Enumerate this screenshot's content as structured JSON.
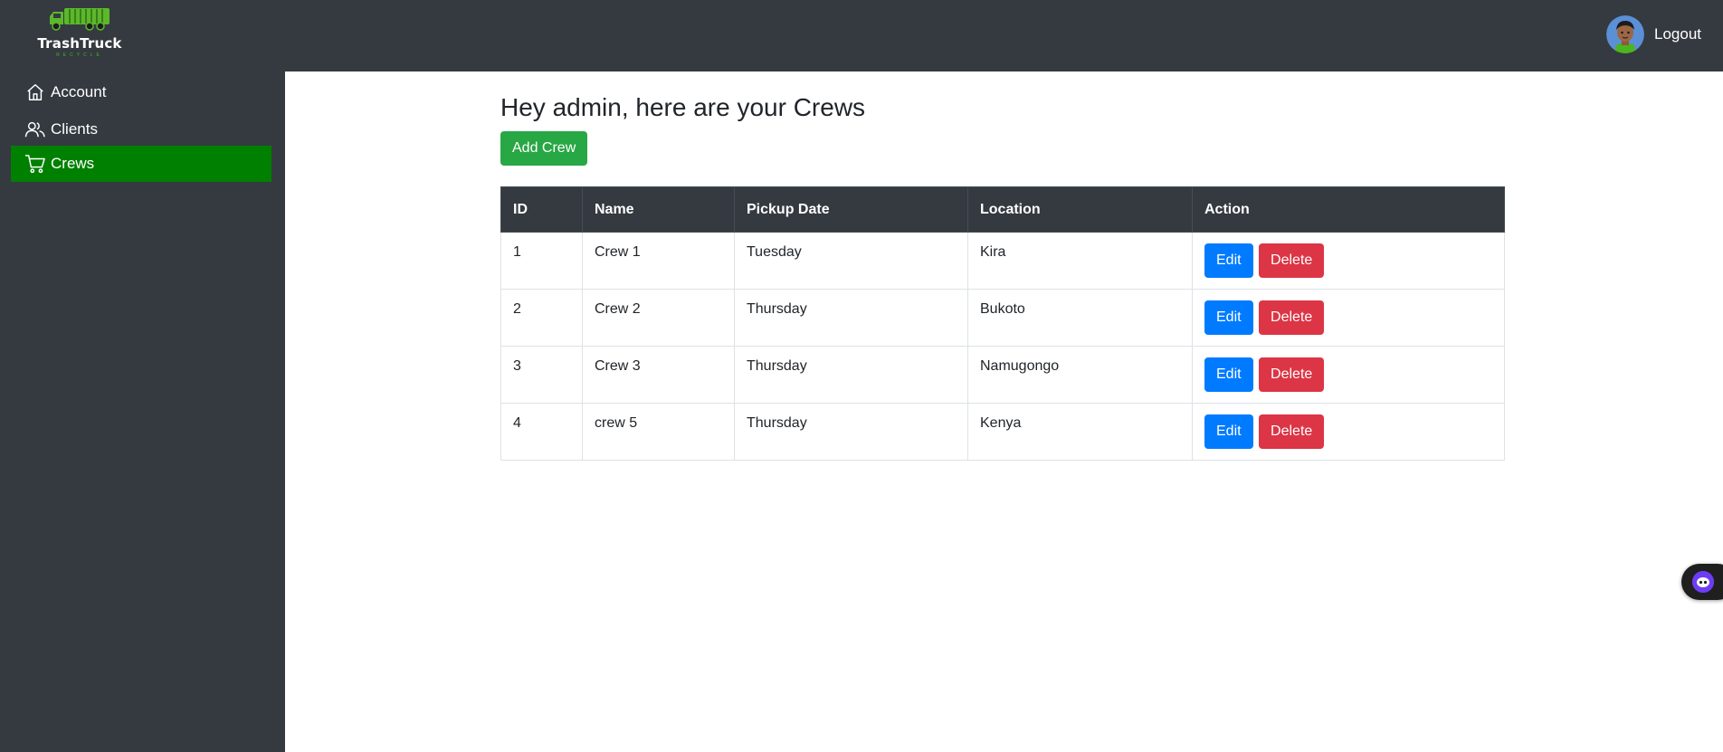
{
  "app": {
    "name": "TrashTruck",
    "tagline": "RECYCLE"
  },
  "header": {
    "logout_label": "Logout"
  },
  "sidebar": {
    "items": [
      {
        "label": "Account",
        "icon": "home-icon",
        "active": false
      },
      {
        "label": "Clients",
        "icon": "users-icon",
        "active": false
      },
      {
        "label": "Crews",
        "icon": "cart-icon",
        "active": true
      }
    ]
  },
  "main": {
    "title": "Hey admin, here are your Crews",
    "add_button": "Add Crew",
    "table": {
      "columns": [
        "ID",
        "Name",
        "Pickup Date",
        "Location",
        "Action"
      ],
      "rows": [
        {
          "id": "1",
          "name": "Crew 1",
          "pickup_date": "Tuesday",
          "location": "Kira"
        },
        {
          "id": "2",
          "name": "Crew 2",
          "pickup_date": "Thursday",
          "location": "Bukoto"
        },
        {
          "id": "3",
          "name": "Crew 3",
          "pickup_date": "Thursday",
          "location": "Namugongo"
        },
        {
          "id": "4",
          "name": "crew 5",
          "pickup_date": "Thursday",
          "location": "Kenya"
        }
      ],
      "edit_label": "Edit",
      "delete_label": "Delete"
    }
  },
  "colors": {
    "sidebar_bg": "#343a40",
    "active_nav": "#008000",
    "success": "#28a745",
    "primary": "#007bff",
    "danger": "#dc3545"
  }
}
